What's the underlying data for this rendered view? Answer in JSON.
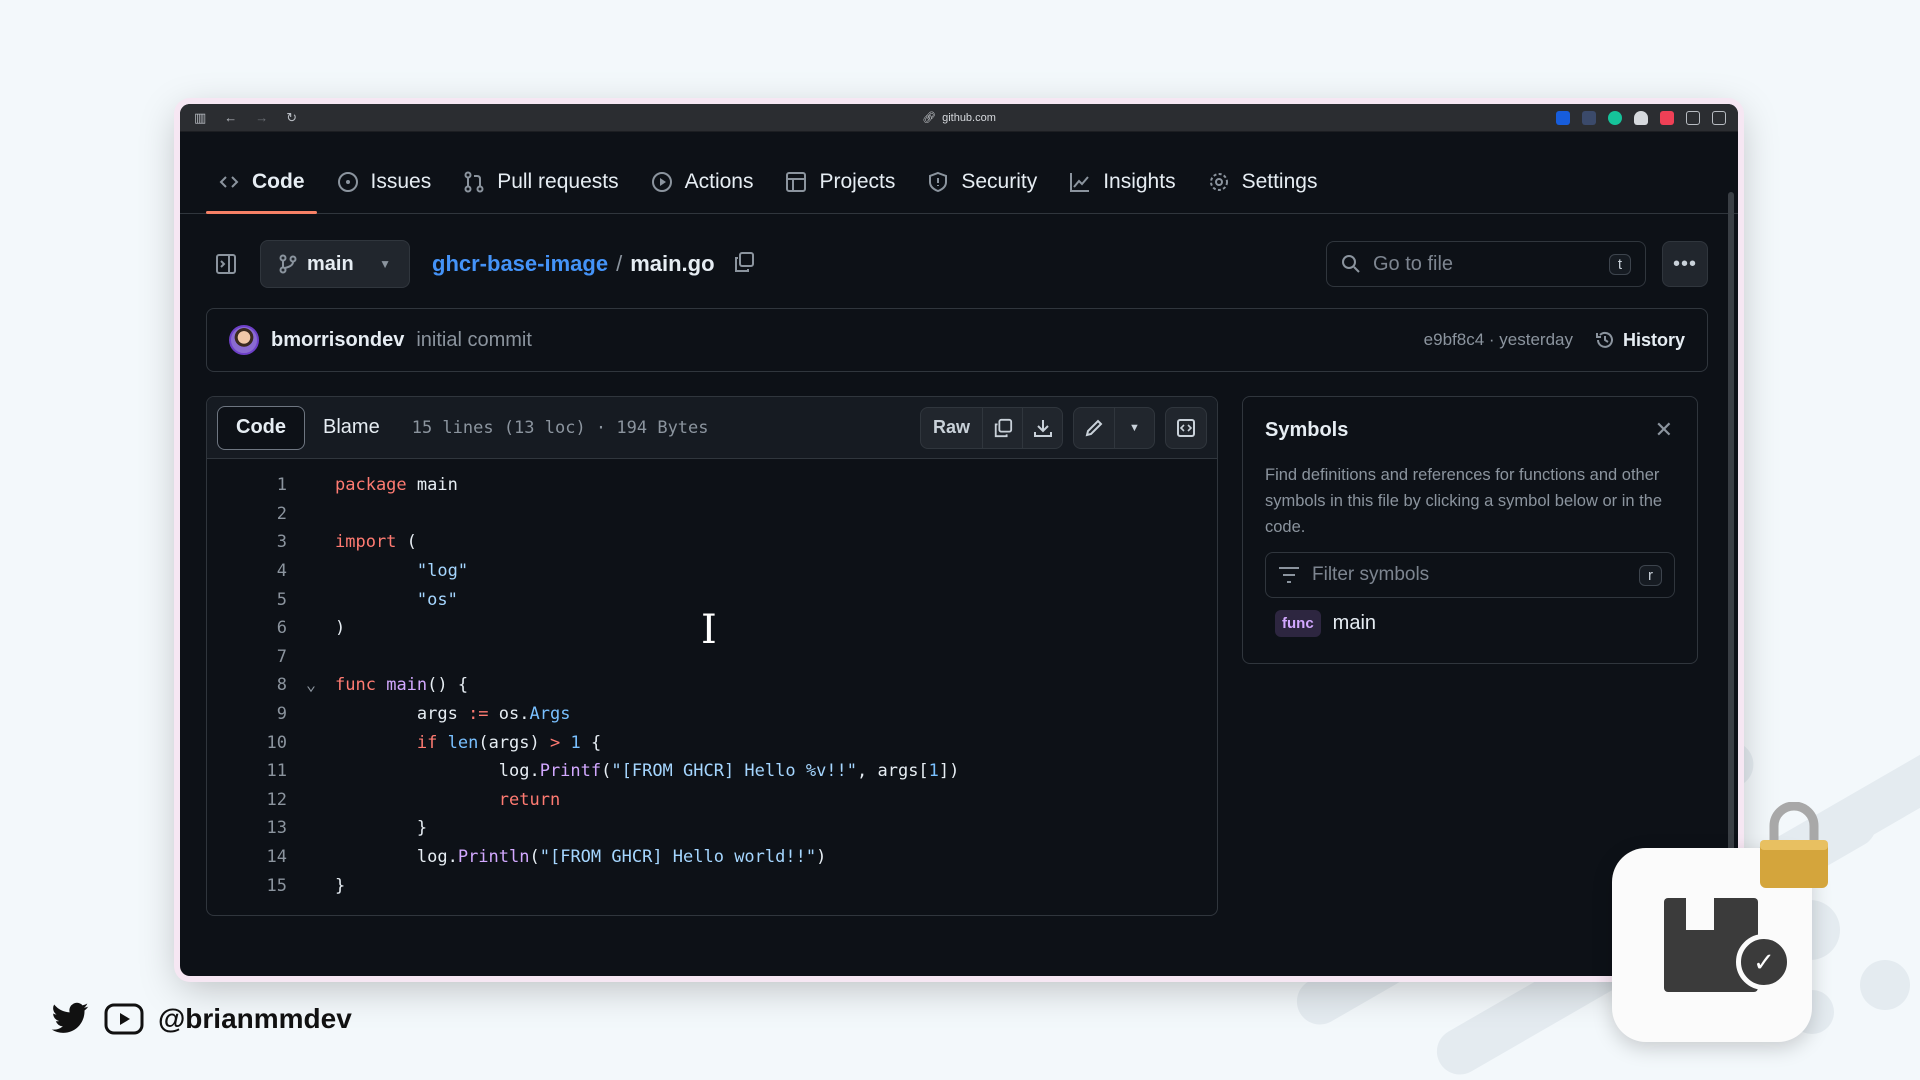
{
  "browser": {
    "url": "github.com"
  },
  "repo_nav": {
    "items": [
      {
        "label": "Code",
        "icon": "code-icon",
        "active": true
      },
      {
        "label": "Issues",
        "icon": "issue-circle-icon"
      },
      {
        "label": "Pull requests",
        "icon": "pull-request-icon"
      },
      {
        "label": "Actions",
        "icon": "play-circle-icon"
      },
      {
        "label": "Projects",
        "icon": "table-icon"
      },
      {
        "label": "Security",
        "icon": "shield-icon"
      },
      {
        "label": "Insights",
        "icon": "graph-icon"
      },
      {
        "label": "Settings",
        "icon": "gear-icon"
      }
    ]
  },
  "file_bar": {
    "branch": "main",
    "repo": "ghcr-base-image",
    "separator": "/",
    "file": "main.go",
    "goto_placeholder": "Go to file",
    "goto_shortcut": "t"
  },
  "commit": {
    "author": "bmorrisondev",
    "message": "initial commit",
    "meta": "e9bf8c4 · yesterday",
    "history": "History"
  },
  "code_view": {
    "tab_code": "Code",
    "tab_blame": "Blame",
    "info": "15 lines (13 loc) · 194 Bytes",
    "raw": "Raw",
    "lines": [
      "package main",
      "",
      "import (",
      "\t\"log\"",
      "\t\"os\"",
      ")",
      "",
      "func main() {",
      "\targs := os.Args",
      "\tif len(args) > 1 {",
      "\t\tlog.Printf(\"[FROM GHCR] Hello %v!!\", args[1])",
      "\t\treturn",
      "\t}",
      "\tlog.Println(\"[FROM GHCR] Hello world!!\")",
      "}"
    ]
  },
  "symbols": {
    "title": "Symbols",
    "description": "Find definitions and references for functions and other symbols in this file by clicking a symbol below or in the code.",
    "filter_placeholder": "Filter symbols",
    "filter_shortcut": "r",
    "items": [
      {
        "kind": "func",
        "name": "main"
      }
    ]
  },
  "social": {
    "handle": "@brianmmdev"
  },
  "colors": {
    "accent_underline": "#f78166",
    "link": "#4493f8",
    "background": "#0d1117"
  }
}
